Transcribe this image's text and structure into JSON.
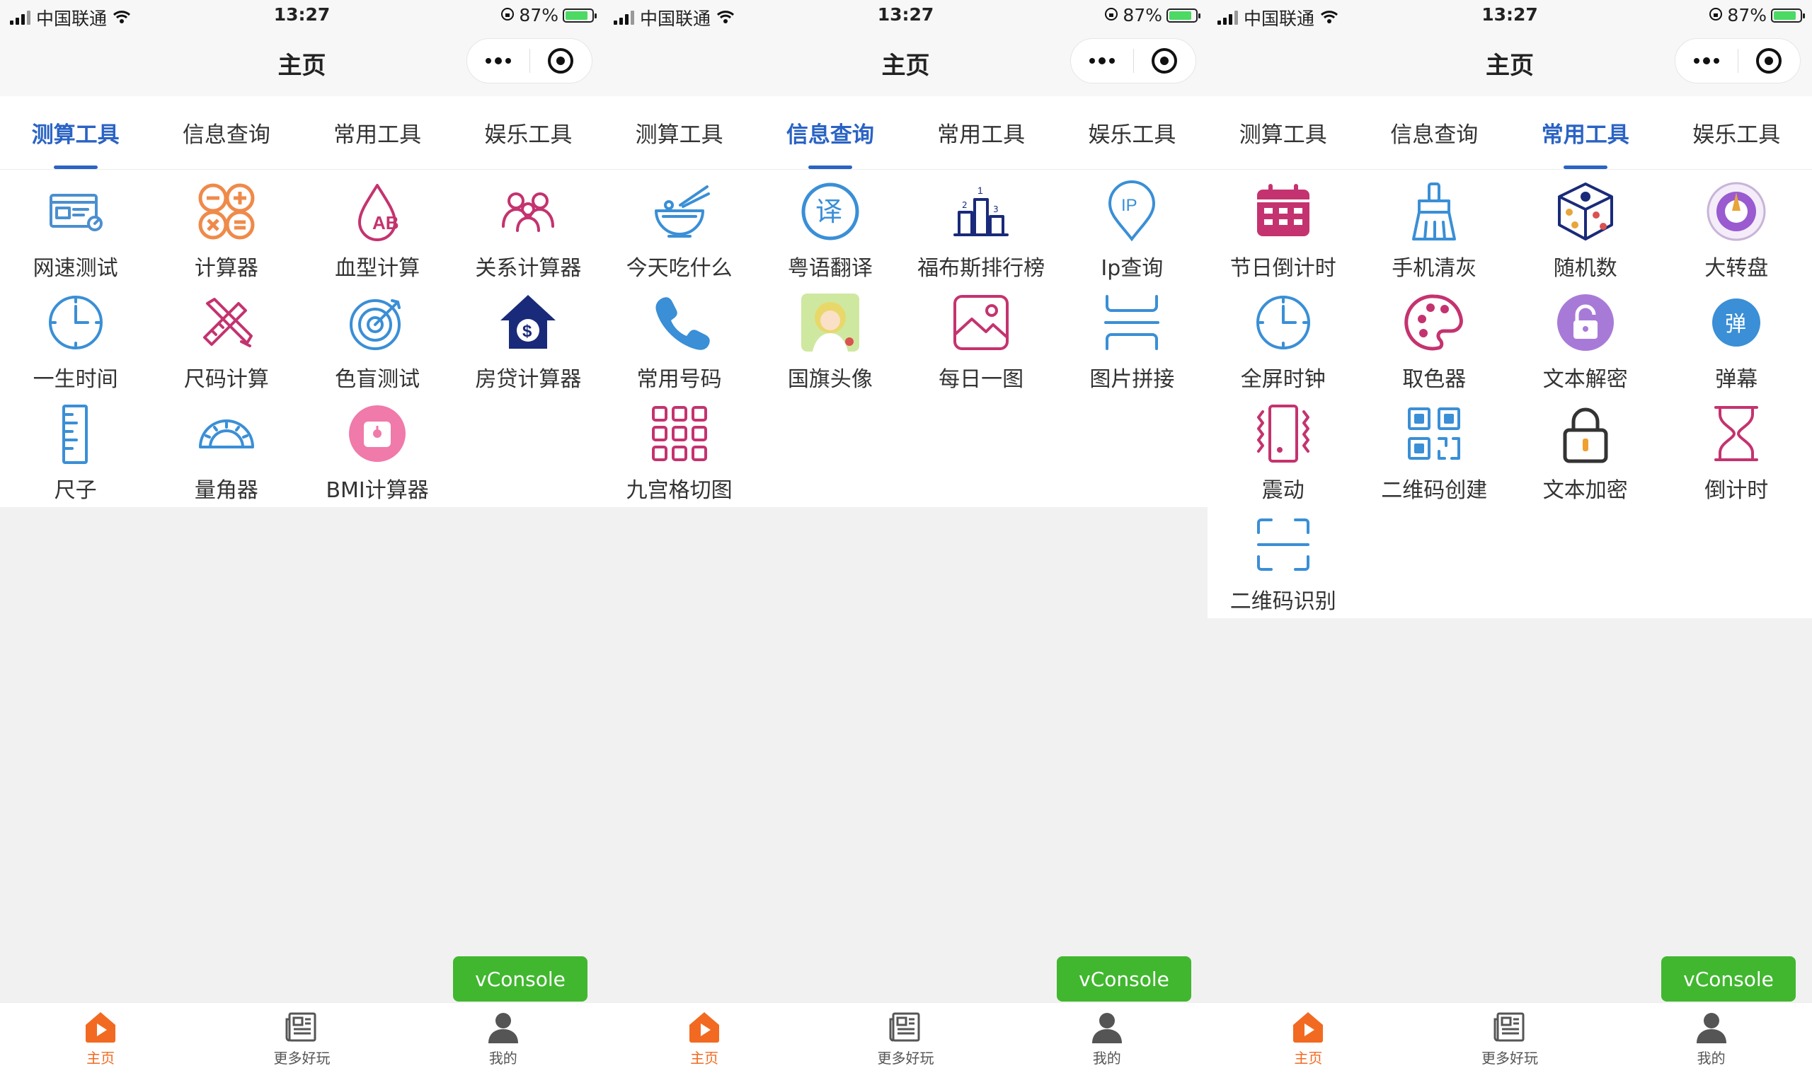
{
  "status": {
    "carrier": "中国联通",
    "time": "13:27",
    "battery": "87%"
  },
  "nav": {
    "title": "主页"
  },
  "tabs": [
    "测算工具",
    "信息查询",
    "常用工具",
    "娱乐工具"
  ],
  "screens": [
    {
      "active_tab": 0,
      "items": [
        {
          "label": "网速测试",
          "icon": "speed-test-icon",
          "color": "#4a8fd0"
        },
        {
          "label": "计算器",
          "icon": "calculator-icon",
          "color": "#ef8a4a"
        },
        {
          "label": "血型计算",
          "icon": "blood-type-icon",
          "color": "#c4336f"
        },
        {
          "label": "关系计算器",
          "icon": "relationship-icon",
          "color": "#c4336f"
        },
        {
          "label": "一生时间",
          "icon": "clock-icon",
          "color": "#3a8fd6"
        },
        {
          "label": "尺码计算",
          "icon": "ruler-pencil-icon",
          "color": "#c4336f"
        },
        {
          "label": "色盲测试",
          "icon": "target-icon",
          "color": "#3a8fd6"
        },
        {
          "label": "房贷计算器",
          "icon": "house-dollar-icon",
          "color": "#1a2a7a"
        },
        {
          "label": "尺子",
          "icon": "ruler-icon",
          "color": "#3a8fd6"
        },
        {
          "label": "量角器",
          "icon": "protractor-icon",
          "color": "#3a8fd6"
        },
        {
          "label": "BMI计算器",
          "icon": "scale-icon",
          "color": "#f07aaa"
        }
      ]
    },
    {
      "active_tab": 1,
      "items": [
        {
          "label": "今天吃什么",
          "icon": "bowl-icon",
          "color": "#3a8fd6"
        },
        {
          "label": "粤语翻译",
          "icon": "translate-icon",
          "color": "#3a8fd6"
        },
        {
          "label": "福布斯排行榜",
          "icon": "podium-icon",
          "color": "#1a2a7a"
        },
        {
          "label": "Ip查询",
          "icon": "ip-pin-icon",
          "color": "#3a8fd6"
        },
        {
          "label": "常用号码",
          "icon": "phone-icon",
          "color": "#3a8fd6"
        },
        {
          "label": "国旗头像",
          "icon": "avatar-flag-icon",
          "color": "#e8d86a"
        },
        {
          "label": "每日一图",
          "icon": "picture-icon",
          "color": "#c4336f"
        },
        {
          "label": "图片拼接",
          "icon": "stitch-icon",
          "color": "#3a8fd6"
        },
        {
          "label": "九宫格切图",
          "icon": "grid-nine-icon",
          "color": "#c4336f"
        }
      ]
    },
    {
      "active_tab": 2,
      "items": [
        {
          "label": "节日倒计时",
          "icon": "calendar-icon",
          "color": "#c4336f"
        },
        {
          "label": "手机清灰",
          "icon": "brush-icon",
          "color": "#3a8fd6"
        },
        {
          "label": "随机数",
          "icon": "dice-icon",
          "color": "#1a2a7a"
        },
        {
          "label": "大转盘",
          "icon": "wheel-icon",
          "color": "#9a5ad0"
        },
        {
          "label": "全屏时钟",
          "icon": "clock-icon",
          "color": "#3a8fd6"
        },
        {
          "label": "取色器",
          "icon": "palette-icon",
          "color": "#c4336f"
        },
        {
          "label": "文本解密",
          "icon": "unlock-icon",
          "color": "#a87ad8"
        },
        {
          "label": "弹幕",
          "icon": "danmu-icon",
          "color": "#3a8fd6"
        },
        {
          "label": "震动",
          "icon": "vibrate-icon",
          "color": "#c4336f"
        },
        {
          "label": "二维码创建",
          "icon": "qrcode-icon",
          "color": "#3a8fd6"
        },
        {
          "label": "文本加密",
          "icon": "lock-icon",
          "color": "#333333"
        },
        {
          "label": "倒计时",
          "icon": "hourglass-icon",
          "color": "#c4336f"
        },
        {
          "label": "二维码识别",
          "icon": "scan-icon",
          "color": "#3a8fd6"
        }
      ]
    }
  ],
  "danmu_char": "弹",
  "ip_text": "IP",
  "translate_char": "译",
  "vconsole": "vConsole",
  "tabbar": [
    {
      "label": "主页",
      "icon": "home-play-icon",
      "active": true
    },
    {
      "label": "更多好玩",
      "icon": "news-icon",
      "active": false
    },
    {
      "label": "我的",
      "icon": "user-icon",
      "active": false
    }
  ],
  "colors": {
    "accent": "#2a63c4",
    "tabbar_active": "#f26a21",
    "vconsole": "#41b72f"
  }
}
